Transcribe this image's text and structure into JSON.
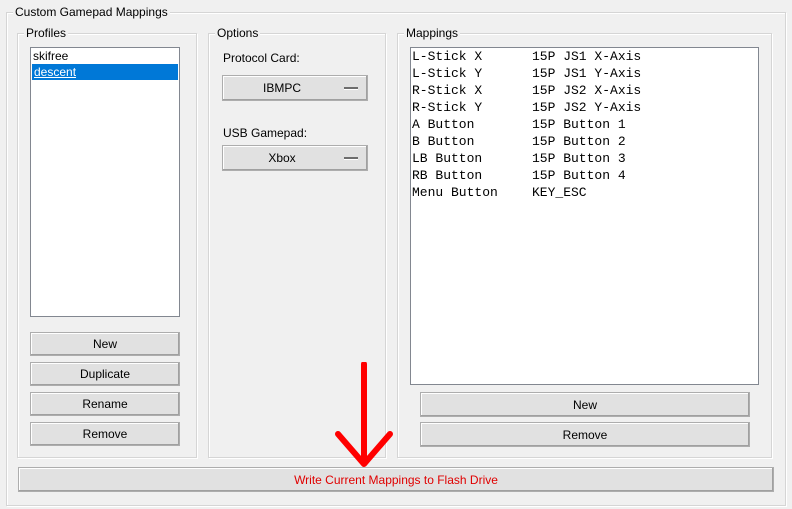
{
  "window": {
    "group_title": "Custom Gamepad Mappings"
  },
  "profiles": {
    "title": "Profiles",
    "items": [
      {
        "label": "skifree",
        "selected": false
      },
      {
        "label": "descent",
        "selected": true
      }
    ],
    "buttons": {
      "new": "New",
      "duplicate": "Duplicate",
      "rename": "Rename",
      "remove": "Remove"
    }
  },
  "options": {
    "title": "Options",
    "protocol_card": {
      "label": "Protocol Card:",
      "value": "IBMPC"
    },
    "usb_gamepad": {
      "label": "USB Gamepad:",
      "value": "Xbox"
    }
  },
  "mappings": {
    "title": "Mappings",
    "rows": [
      {
        "input": "L-Stick X",
        "output": "15P JS1 X-Axis"
      },
      {
        "input": "L-Stick Y",
        "output": "15P JS1 Y-Axis"
      },
      {
        "input": "R-Stick X",
        "output": "15P JS2 X-Axis"
      },
      {
        "input": "R-Stick Y",
        "output": "15P JS2 Y-Axis"
      },
      {
        "input": "A Button",
        "output": "15P Button 1"
      },
      {
        "input": "B Button",
        "output": "15P Button 2"
      },
      {
        "input": "LB Button",
        "output": "15P Button 3"
      },
      {
        "input": "RB Button",
        "output": "15P Button 4"
      },
      {
        "input": "Menu Button",
        "output": "KEY_ESC"
      }
    ],
    "buttons": {
      "new": "New",
      "remove": "Remove"
    }
  },
  "write_button": {
    "label": "Write Current Mappings to Flash Drive",
    "color": "#e00000"
  },
  "annotation": {
    "icon": "red-down-arrow-icon",
    "color": "#ff0000"
  }
}
